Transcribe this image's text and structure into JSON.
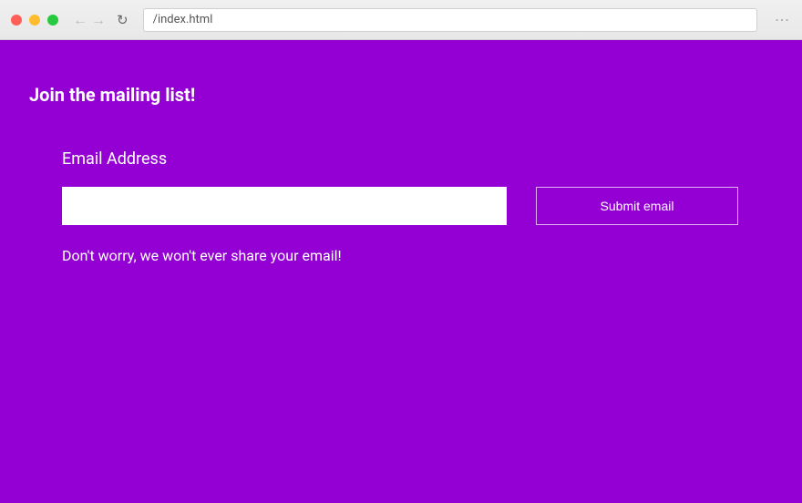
{
  "browser": {
    "url": "/index.html"
  },
  "page": {
    "title": "Join the mailing list!",
    "form": {
      "label": "Email Address",
      "email_value": "",
      "submit_label": "Submit email",
      "helper_text": "Don't worry, we won't ever share your email!"
    }
  },
  "colors": {
    "background": "#9400d3",
    "text": "#ffffff"
  }
}
